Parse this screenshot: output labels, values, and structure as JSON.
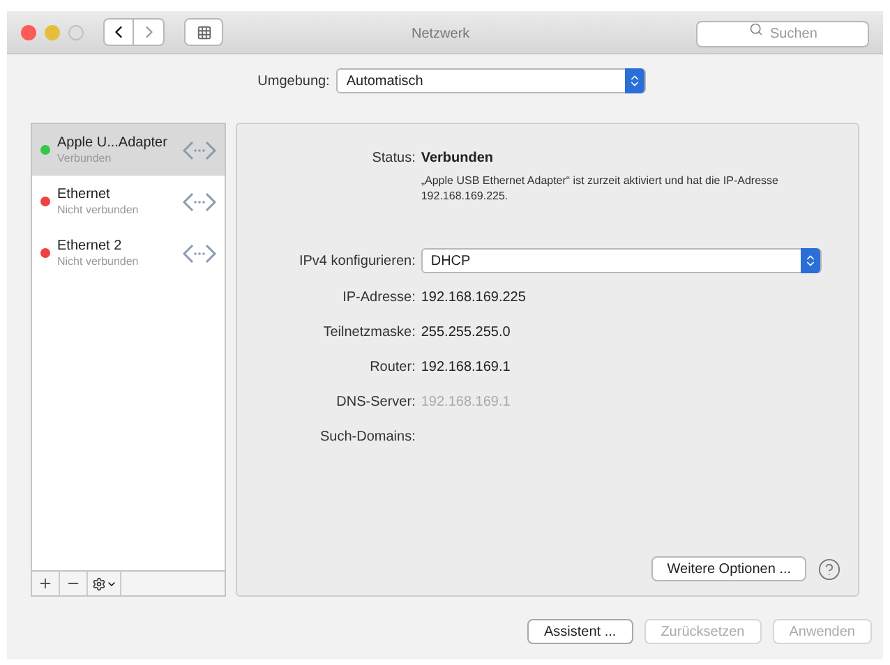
{
  "window": {
    "title": "Netzwerk"
  },
  "search": {
    "placeholder": "Suchen"
  },
  "location": {
    "label": "Umgebung:",
    "value": "Automatisch"
  },
  "services": [
    {
      "name": "Apple U...Adapter",
      "status": "Verbunden",
      "selected": true,
      "color": "#34c748"
    },
    {
      "name": "Ethernet",
      "status": "Nicht verbunden",
      "selected": false,
      "color": "#f04040"
    },
    {
      "name": "Ethernet 2",
      "status": "Nicht verbunden",
      "selected": false,
      "color": "#f04040"
    }
  ],
  "status": {
    "label": "Status:",
    "value": "Verbunden",
    "description": "„Apple USB Ethernet Adapter“ ist zurzeit aktiviert und hat die IP-Adresse 192.168.169.225."
  },
  "ipv4": {
    "label": "IPv4 konfigurieren:",
    "value": "DHCP"
  },
  "details": [
    {
      "label": "IP-Adresse:",
      "value": "192.168.169.225",
      "disabled": false
    },
    {
      "label": "Teilnetzmaske:",
      "value": "255.255.255.0",
      "disabled": false
    },
    {
      "label": "Router:",
      "value": "192.168.169.1",
      "disabled": false
    },
    {
      "label": "DNS-Server:",
      "value": "192.168.169.1",
      "disabled": true
    },
    {
      "label": "Such-Domains:"
    }
  ],
  "advanced_button": "Weitere Optionen ...",
  "buttons": [
    {
      "label": "Assistent ...",
      "disabled": false
    },
    {
      "label": "Zurücksetzen",
      "disabled": true
    },
    {
      "label": "Anwenden",
      "disabled": true
    }
  ]
}
